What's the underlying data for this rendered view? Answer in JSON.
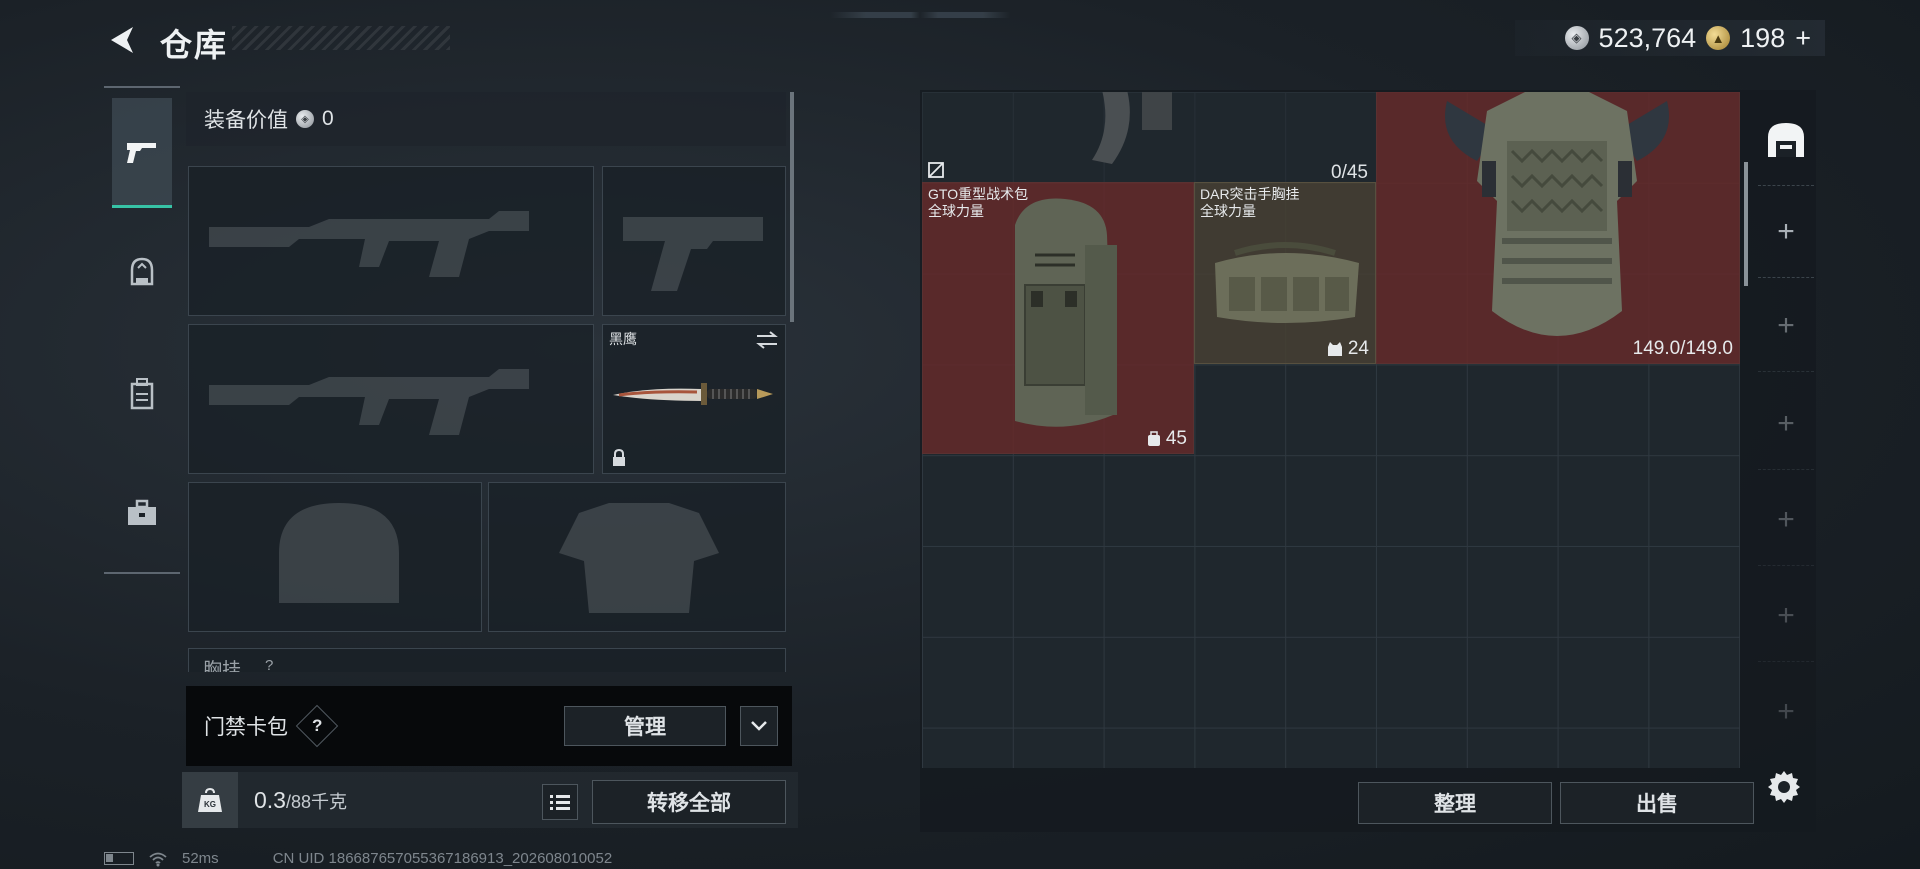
{
  "header": {
    "title": "仓库",
    "back_icon": "back-arrow-icon",
    "currency_silver": "523,764",
    "currency_gold": "198",
    "currency_gold_plus": "+"
  },
  "left_tabs": [
    {
      "icon": "pistol-icon",
      "active": true
    },
    {
      "icon": "helmet-icon",
      "active": false
    },
    {
      "icon": "backpack-icon",
      "active": false
    },
    {
      "icon": "toolbox-icon",
      "active": false
    }
  ],
  "equipment": {
    "value_label": "装备价值",
    "value": "0",
    "knife": {
      "name": "黑鹰",
      "swap_icon": "swap-icon",
      "lock_icon": "lock-icon"
    },
    "chest_label": "胸挂",
    "chest_hint": "?"
  },
  "card_bar": {
    "label": "门禁卡包",
    "help": "?",
    "manage_label": "管理"
  },
  "weight": {
    "current": "0.3",
    "max": "/88千克",
    "icon_text": "KG",
    "transfer_label": "转移全部"
  },
  "storage": {
    "top_item_capacity": "0/45",
    "items": [
      {
        "name_line1": "GTO重型战术包",
        "name_line2": "全球力量",
        "stat": "45",
        "stat_icon": "backpack-small-icon"
      },
      {
        "name_line1": "DAR突击手胸挂",
        "name_line2": "全球力量",
        "stat": "24",
        "stat_icon": "vest-small-icon"
      },
      {
        "name_line1": "",
        "name_line2": "",
        "stat": "149.0/149.0",
        "stat_icon": ""
      }
    ],
    "sort_label": "整理",
    "sell_label": "出售"
  },
  "right_tabs": {
    "add_symbol": "+"
  },
  "footer": {
    "ping": "52ms",
    "uid": "CN UID 186687657055367186913_202608010052"
  }
}
